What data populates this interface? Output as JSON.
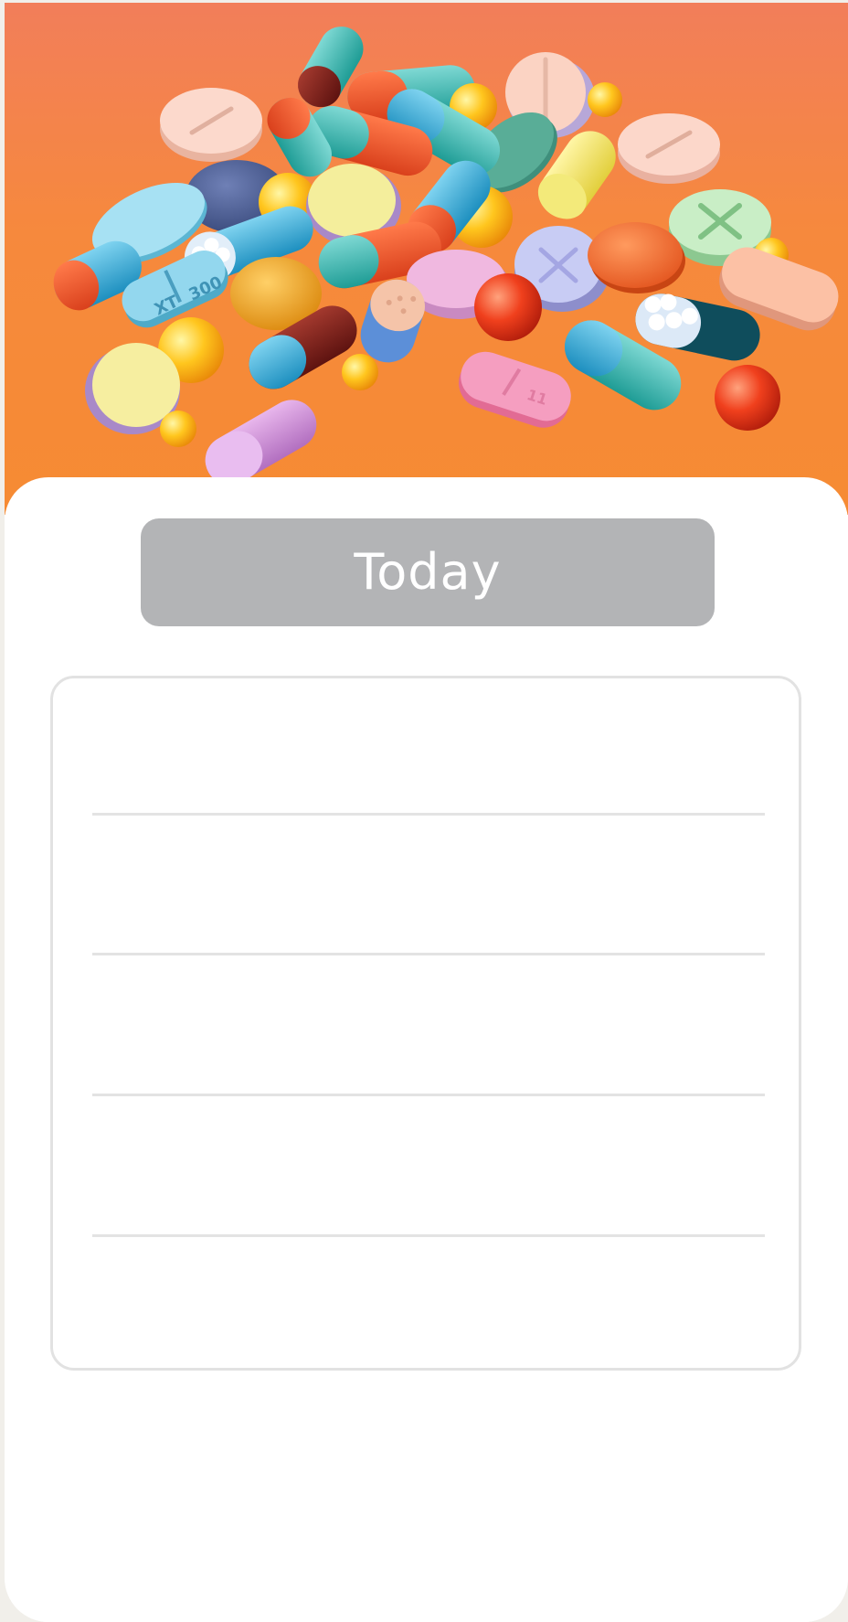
{
  "hero": {
    "image": "medication-pills-illustration",
    "background_colors": [
      "#f27e5a",
      "#f68b33"
    ]
  },
  "today_button": {
    "label": "Today",
    "color": "#b3b4b6"
  },
  "pill_imprints": [
    "XT",
    "300",
    "11"
  ],
  "medication_list": {
    "slots": [
      {
        "text": ""
      },
      {
        "text": ""
      },
      {
        "text": ""
      },
      {
        "text": ""
      },
      {
        "text": ""
      }
    ]
  }
}
